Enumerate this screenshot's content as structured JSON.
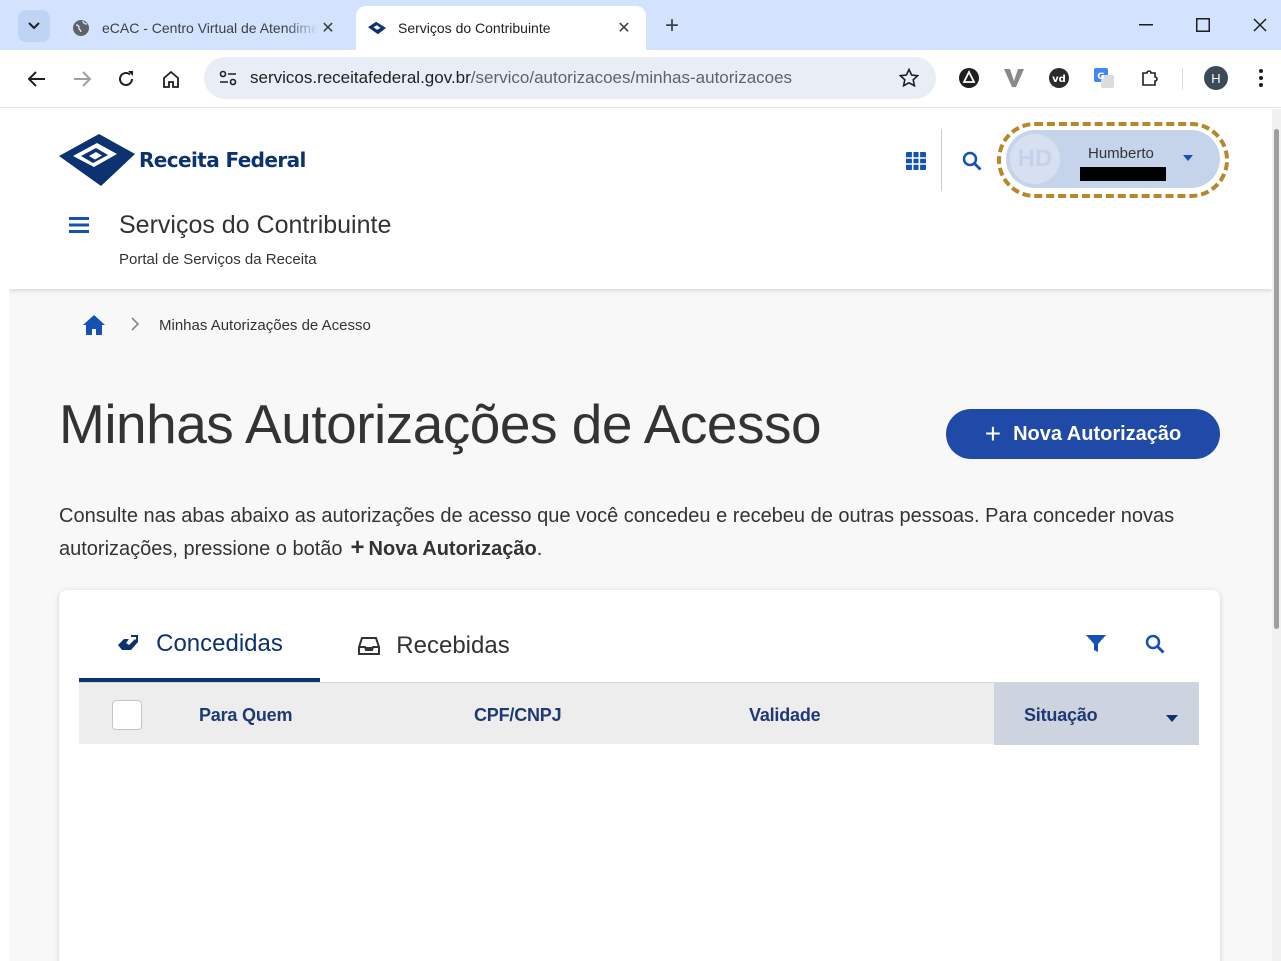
{
  "browser": {
    "tabs": [
      {
        "title": "eCAC - Centro Virtual de Atendimento",
        "active": false
      },
      {
        "title": "Serviços do Contribuinte",
        "active": true
      }
    ],
    "url_host": "servicos.receitafederal.gov.br",
    "url_path": "/servico/autorizacoes/minhas-autorizacoes",
    "profile_initial": "H",
    "colors": {
      "tabbar": "#d3e3fd",
      "omnibox": "#e9eef6"
    }
  },
  "header": {
    "logo_text": "Receita Federal",
    "user": {
      "initials": "HD",
      "name": "Humberto"
    },
    "service_title": "Serviços do Contribuinte",
    "service_subtitle": "Portal de Serviços da Receita"
  },
  "breadcrumb": {
    "current": "Minhas Autorizações de Acesso"
  },
  "main": {
    "title": "Minhas Autorizações de Acesso",
    "new_button_label": "Nova Autorização",
    "description_text": "Consulte nas abas abaixo as autorizações de acesso que você concedeu e recebeu de outras pessoas. Para conceder novas autorizações, pressione o botão",
    "description_button": "Nova Autorização",
    "description_end": "."
  },
  "tabs": [
    {
      "label": "Concedidas",
      "active": true
    },
    {
      "label": "Recebidas",
      "active": false
    }
  ],
  "table": {
    "columns": [
      "Para Quem",
      "CPF/CNPJ",
      "Validade",
      "Situação"
    ],
    "sorted_column": "Situação",
    "rows": []
  },
  "colors": {
    "primary": "#1f4aa8",
    "navy": "#0c326f",
    "highlight_outline": "#b8862b"
  }
}
